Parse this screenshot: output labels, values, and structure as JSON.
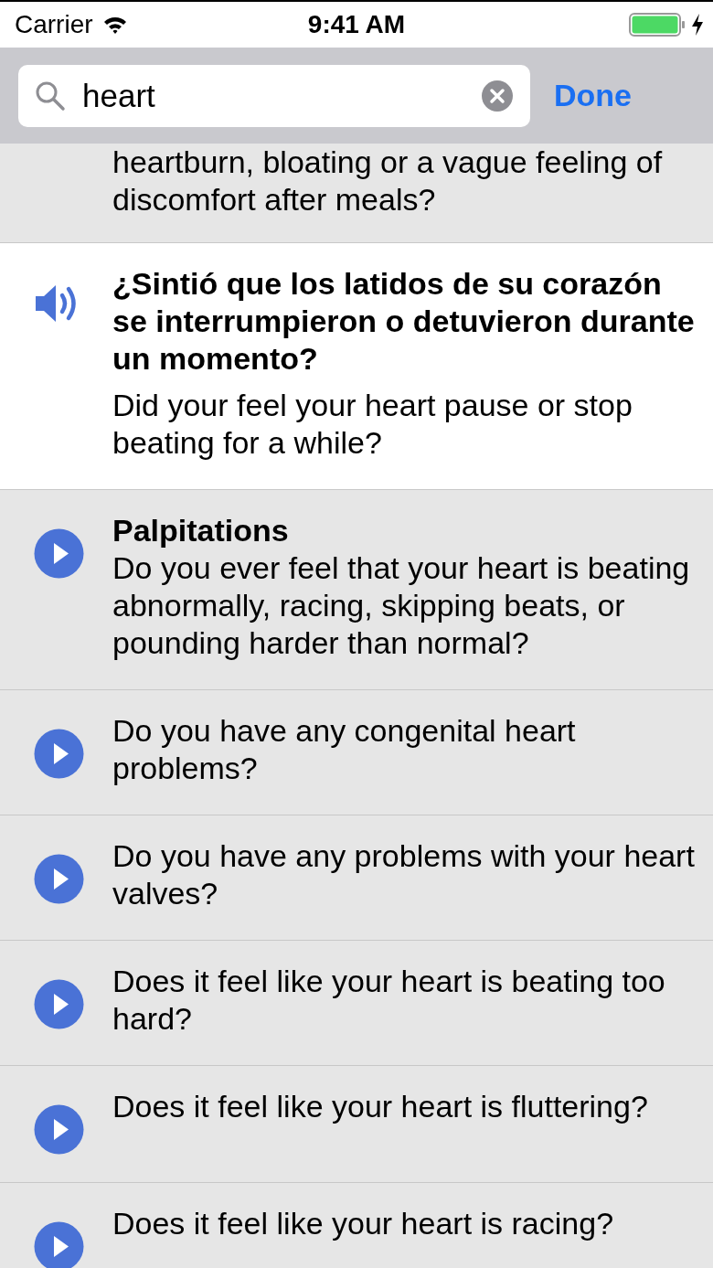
{
  "status_bar": {
    "carrier": "Carrier",
    "time": "9:41 AM"
  },
  "search": {
    "value": "heart",
    "action": "Done"
  },
  "rows": [
    {
      "kind": "continued",
      "selected": false,
      "text": "heartburn, bloating or a vague feeling of discomfort after meals?"
    },
    {
      "kind": "audio",
      "selected": true,
      "title": "¿Sintió que los latidos de su corazón se interrumpieron o detuvieron durante un momento?",
      "text": "Did your feel your heart pause or stop beating for a while?"
    },
    {
      "kind": "audio",
      "selected": false,
      "title": "Palpitations",
      "text": "Do you ever feel that your heart is beating abnormally, racing, skipping beats, or pounding harder than normal?"
    },
    {
      "kind": "audio",
      "selected": false,
      "text": "Do you have any congenital heart problems?"
    },
    {
      "kind": "audio",
      "selected": false,
      "text": "Do you have any problems with your heart valves?"
    },
    {
      "kind": "audio",
      "selected": false,
      "text": "Does it feel like your heart is beating too hard?"
    },
    {
      "kind": "audio",
      "selected": false,
      "text": "Does it feel like your heart is fluttering?"
    },
    {
      "kind": "audio",
      "selected": false,
      "text": "Does it feel like your heart is racing?"
    }
  ]
}
